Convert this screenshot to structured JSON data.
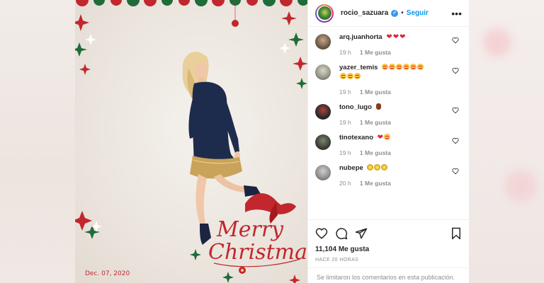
{
  "post": {
    "author": "rocio_sazuara",
    "separator": "•",
    "follow_label": "Seguir",
    "more_label": "•••",
    "photo_date": "Dec. 07, 2020",
    "photo_caption_art": "Merry Christmas",
    "likes_text": "11,104 Me gusta",
    "timestamp": "HACE 20 HORAS",
    "comments_disabled_text": "Se limitaron los comentarios en esta publicación."
  },
  "comments": [
    {
      "user": "arq.juanhorta",
      "text": "",
      "emojis": [
        "heart",
        "heart",
        "heart"
      ],
      "time": "19 h",
      "likes": "1 Me gusta",
      "avatar_color": "#6b5a48"
    },
    {
      "user": "yazer_temis",
      "text": "",
      "emojis": [
        "face",
        "face",
        "face",
        "face",
        "face",
        "face",
        "face",
        "face",
        "face"
      ],
      "time": "19 h",
      "likes": "1 Me gusta",
      "avatar_color": "#9a9a8a"
    },
    {
      "user": "tono_lugo",
      "text": "",
      "emojis": [
        "fist"
      ],
      "time": "19 h",
      "likes": "1 Me gusta",
      "avatar_color": "#2b2b2b"
    },
    {
      "user": "tinotexano",
      "text": "",
      "emojis": [
        "heart",
        "face"
      ],
      "time": "19 h",
      "likes": "1 Me gusta",
      "avatar_color": "#3a3f36"
    },
    {
      "user": "nubepe",
      "text": "",
      "emojis": [
        "burst",
        "burst",
        "burst"
      ],
      "time": "20 h",
      "likes": "1 Me gusta",
      "avatar_color": "#8c8c8c"
    }
  ],
  "icons": {
    "like": "heart-outline-icon",
    "comment": "comment-bubble-icon",
    "share": "paper-plane-icon",
    "save": "bookmark-icon",
    "verified": "verified-badge-icon"
  },
  "colors": {
    "accent_link": "#0095f6",
    "verified": "#3897f0",
    "text_primary": "#262626",
    "text_secondary": "#8e8e8e",
    "holiday_red": "#c1272d",
    "holiday_green": "#1f6b3a"
  }
}
